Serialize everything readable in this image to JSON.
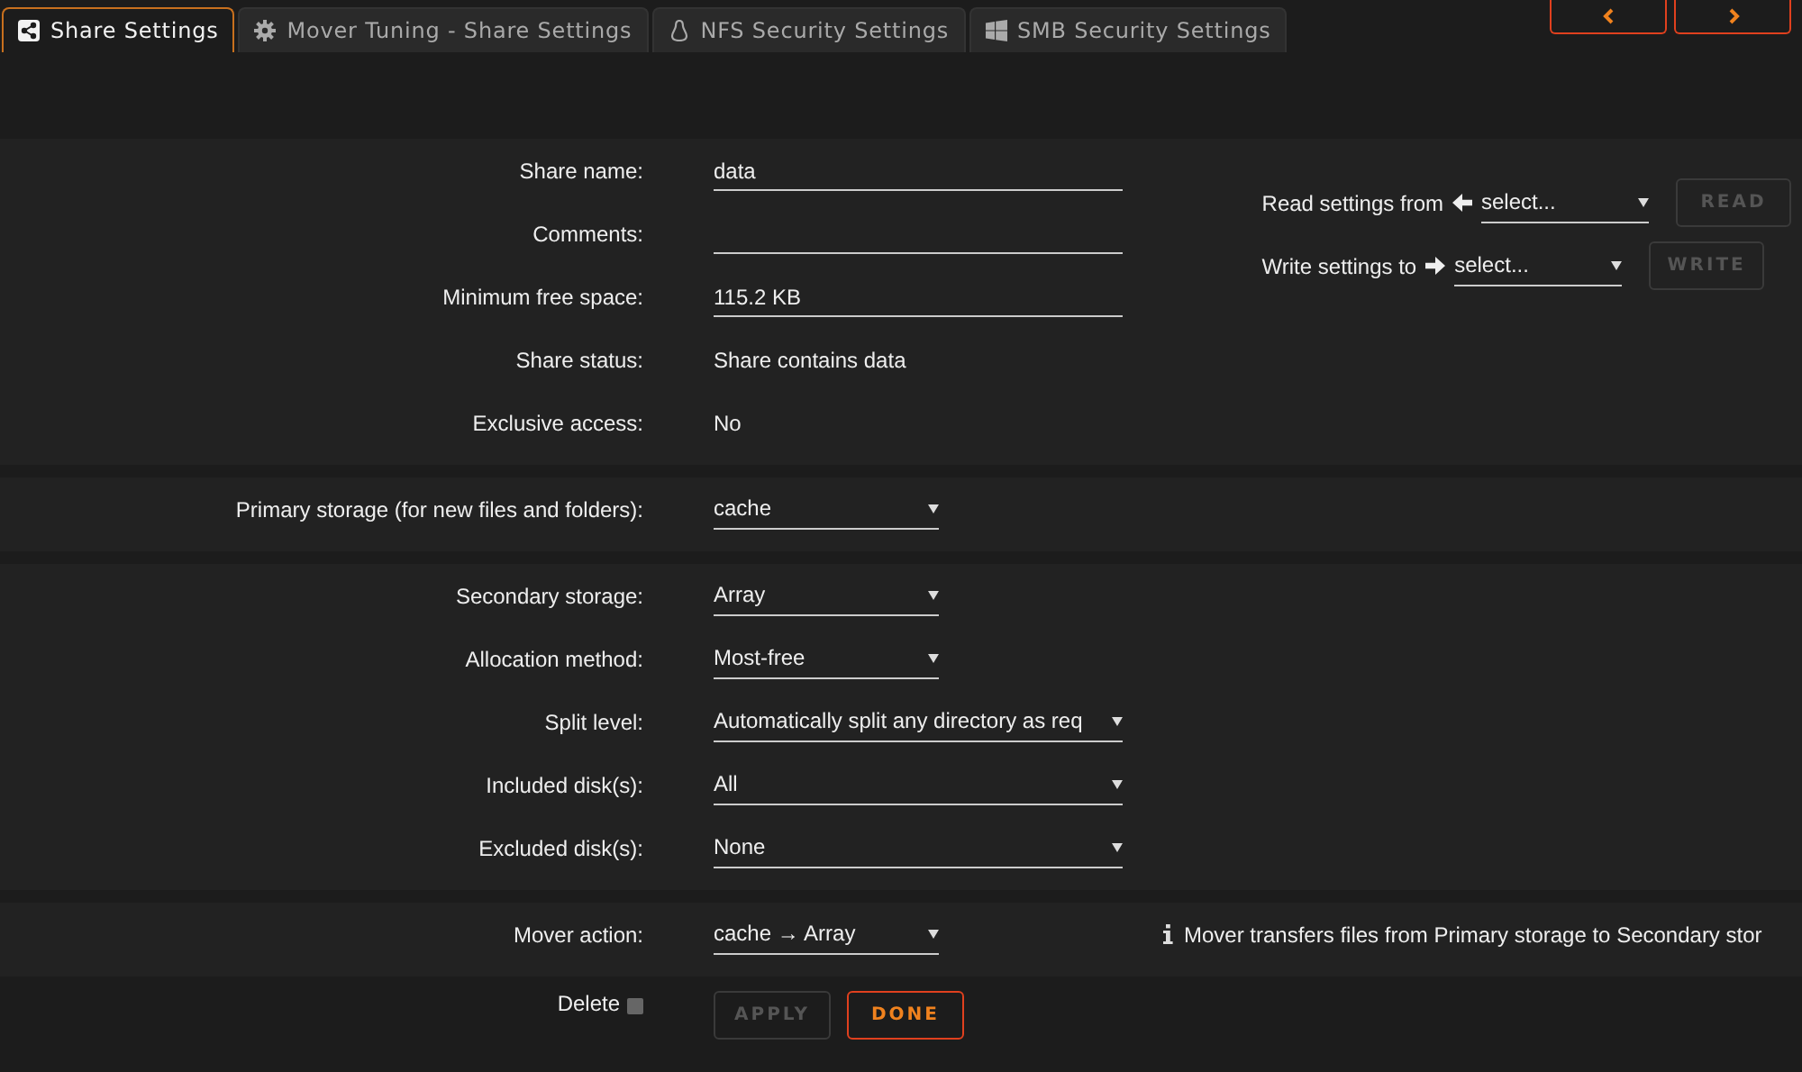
{
  "tabs": [
    {
      "label": "Share Settings",
      "selected": true
    },
    {
      "label": "Mover Tuning - Share Settings",
      "selected": false
    },
    {
      "label": "NFS Security Settings",
      "selected": false
    },
    {
      "label": "SMB Security Settings",
      "selected": false
    }
  ],
  "sections": [
    {
      "rows": [
        {
          "label": "Share name:",
          "kind": "input",
          "value": "data"
        },
        {
          "label": "Comments:",
          "kind": "input",
          "value": ""
        },
        {
          "label": "Minimum free space:",
          "kind": "input",
          "value": "115.2 KB"
        },
        {
          "label": "Share status:",
          "kind": "text",
          "value": "Share contains data"
        },
        {
          "label": "Exclusive access:",
          "kind": "text",
          "value": "No"
        }
      ]
    },
    {
      "rows": [
        {
          "label": "Primary storage (for new files and folders):",
          "kind": "select",
          "value": "cache"
        }
      ]
    },
    {
      "rows": [
        {
          "label": "Secondary storage:",
          "kind": "select",
          "value": "Array"
        },
        {
          "label": "Allocation method:",
          "kind": "select",
          "value": "Most-free"
        },
        {
          "label": "Split level:",
          "kind": "wideselect",
          "value": "Automatically split any directory as req"
        },
        {
          "label": "Included disk(s):",
          "kind": "wideselect",
          "value": "All"
        },
        {
          "label": "Excluded disk(s):",
          "kind": "wideselect",
          "value": "None"
        }
      ]
    },
    {
      "rows": [
        {
          "label": "Mover action:",
          "kind": "select",
          "value": "cache → Array"
        }
      ],
      "note": "Mover transfers files from Primary storage to Secondary stor"
    }
  ],
  "copy": [
    {
      "label": "Read settings from",
      "kind": "read",
      "value": "select...",
      "button": "READ",
      "disabled": true
    },
    {
      "label": "Write settings to",
      "kind": "write",
      "value": "select...",
      "button": "WRITE",
      "disabled": true
    }
  ],
  "delete": {
    "label": "Delete",
    "checked": false
  },
  "buttons": [
    {
      "label": "APPLY",
      "disabled": true
    },
    {
      "label": "DONE",
      "disabled": false
    }
  ]
}
